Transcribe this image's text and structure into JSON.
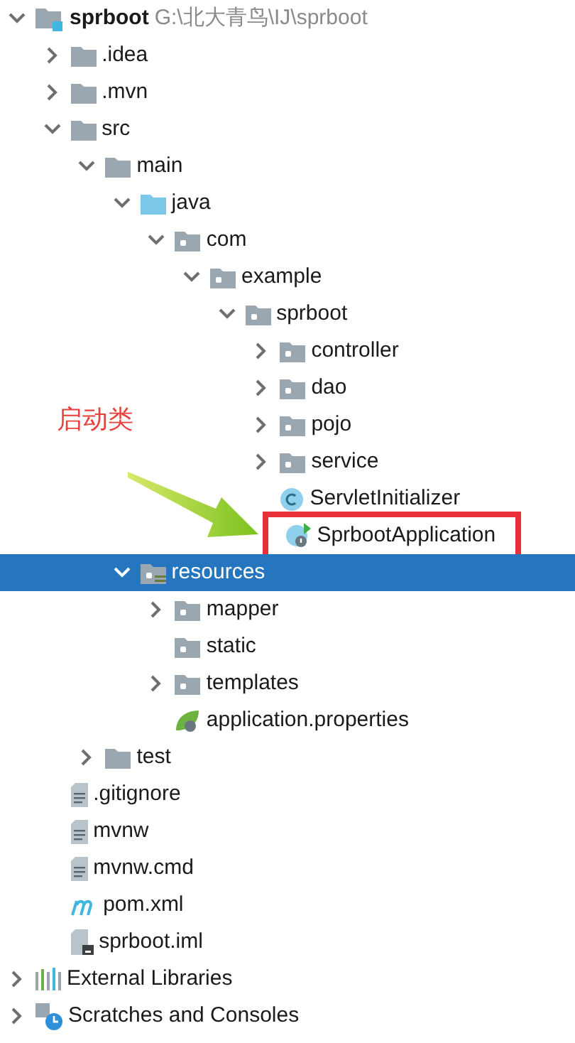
{
  "annotation": {
    "label": "启动类"
  },
  "tree": [
    {
      "name": "sprboot",
      "kind": "project",
      "path": "G:\\北大青鸟\\IJ\\sprboot",
      "expanded": true,
      "selected": false,
      "children": [
        {
          "name": ".idea",
          "kind": "folder",
          "expanded": false,
          "selected": false
        },
        {
          "name": ".mvn",
          "kind": "folder",
          "expanded": false,
          "selected": false
        },
        {
          "name": "src",
          "kind": "folder",
          "expanded": true,
          "selected": false,
          "children": [
            {
              "name": "main",
              "kind": "folder",
              "expanded": true,
              "selected": false,
              "children": [
                {
                  "name": "java",
                  "kind": "source",
                  "expanded": true,
                  "selected": false,
                  "children": [
                    {
                      "name": "com",
                      "kind": "package",
                      "expanded": true,
                      "selected": false,
                      "children": [
                        {
                          "name": "example",
                          "kind": "package",
                          "expanded": true,
                          "selected": false,
                          "children": [
                            {
                              "name": "sprboot",
                              "kind": "package",
                              "expanded": true,
                              "selected": false,
                              "children": [
                                {
                                  "name": "controller",
                                  "kind": "package",
                                  "expanded": false,
                                  "selected": false
                                },
                                {
                                  "name": "dao",
                                  "kind": "package",
                                  "expanded": false,
                                  "selected": false
                                },
                                {
                                  "name": "pojo",
                                  "kind": "package",
                                  "expanded": false,
                                  "selected": false
                                },
                                {
                                  "name": "service",
                                  "kind": "package",
                                  "expanded": false,
                                  "selected": false
                                },
                                {
                                  "name": "ServletInitializer",
                                  "kind": "class",
                                  "selected": false,
                                  "highlighted": false
                                },
                                {
                                  "name": "SprbootApplication",
                                  "kind": "spring-class",
                                  "selected": false,
                                  "highlighted": true
                                }
                              ]
                            }
                          ]
                        }
                      ]
                    }
                  ]
                },
                {
                  "name": "resources",
                  "kind": "resources",
                  "expanded": true,
                  "selected": true,
                  "children": [
                    {
                      "name": "mapper",
                      "kind": "package",
                      "expanded": false,
                      "selected": false
                    },
                    {
                      "name": "static",
                      "kind": "package",
                      "selected": false
                    },
                    {
                      "name": "templates",
                      "kind": "package",
                      "expanded": false,
                      "selected": false
                    },
                    {
                      "name": "application.properties",
                      "kind": "spring-config",
                      "selected": false
                    }
                  ]
                }
              ]
            },
            {
              "name": "test",
              "kind": "folder",
              "expanded": false,
              "selected": false
            }
          ]
        },
        {
          "name": ".gitignore",
          "kind": "file",
          "selected": false
        },
        {
          "name": "mvnw",
          "kind": "file",
          "selected": false
        },
        {
          "name": "mvnw.cmd",
          "kind": "file",
          "selected": false
        },
        {
          "name": "pom.xml",
          "kind": "maven",
          "selected": false
        },
        {
          "name": "sprboot.iml",
          "kind": "iml",
          "selected": false
        }
      ]
    },
    {
      "name": "External Libraries",
      "kind": "libraries",
      "expanded": false,
      "selected": false
    },
    {
      "name": "Scratches and Consoles",
      "kind": "scratches",
      "expanded": false,
      "selected": false
    }
  ]
}
